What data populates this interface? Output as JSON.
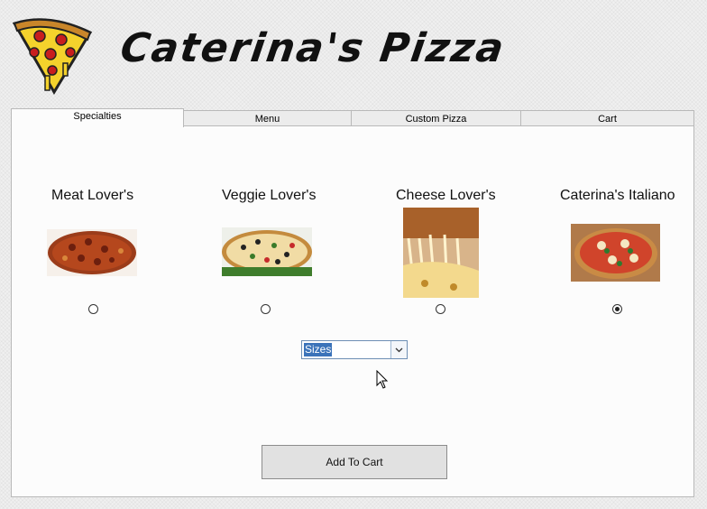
{
  "app": {
    "title": "Caterina's Pizza",
    "logo": "pizza-slice-icon"
  },
  "tabs": [
    {
      "label": "Specialties",
      "active": true
    },
    {
      "label": "Menu",
      "active": false
    },
    {
      "label": "Custom Pizza",
      "active": false
    },
    {
      "label": "Cart",
      "active": false
    }
  ],
  "specialties": [
    {
      "name": "Meat Lover's",
      "image": "meat-lovers-pizza",
      "selected": false
    },
    {
      "name": "Veggie Lover's",
      "image": "veggie-lovers-pizza",
      "selected": false
    },
    {
      "name": "Cheese Lover's",
      "image": "cheese-lovers-pizza",
      "selected": false
    },
    {
      "name": "Caterina's Italiano",
      "image": "caterinas-italiano-pizza",
      "selected": true
    }
  ],
  "size_select": {
    "value": "Sizes"
  },
  "add_to_cart": {
    "label": "Add To Cart"
  },
  "colors": {
    "selection": "#3b73b9",
    "panel": "#fcfcfc"
  }
}
